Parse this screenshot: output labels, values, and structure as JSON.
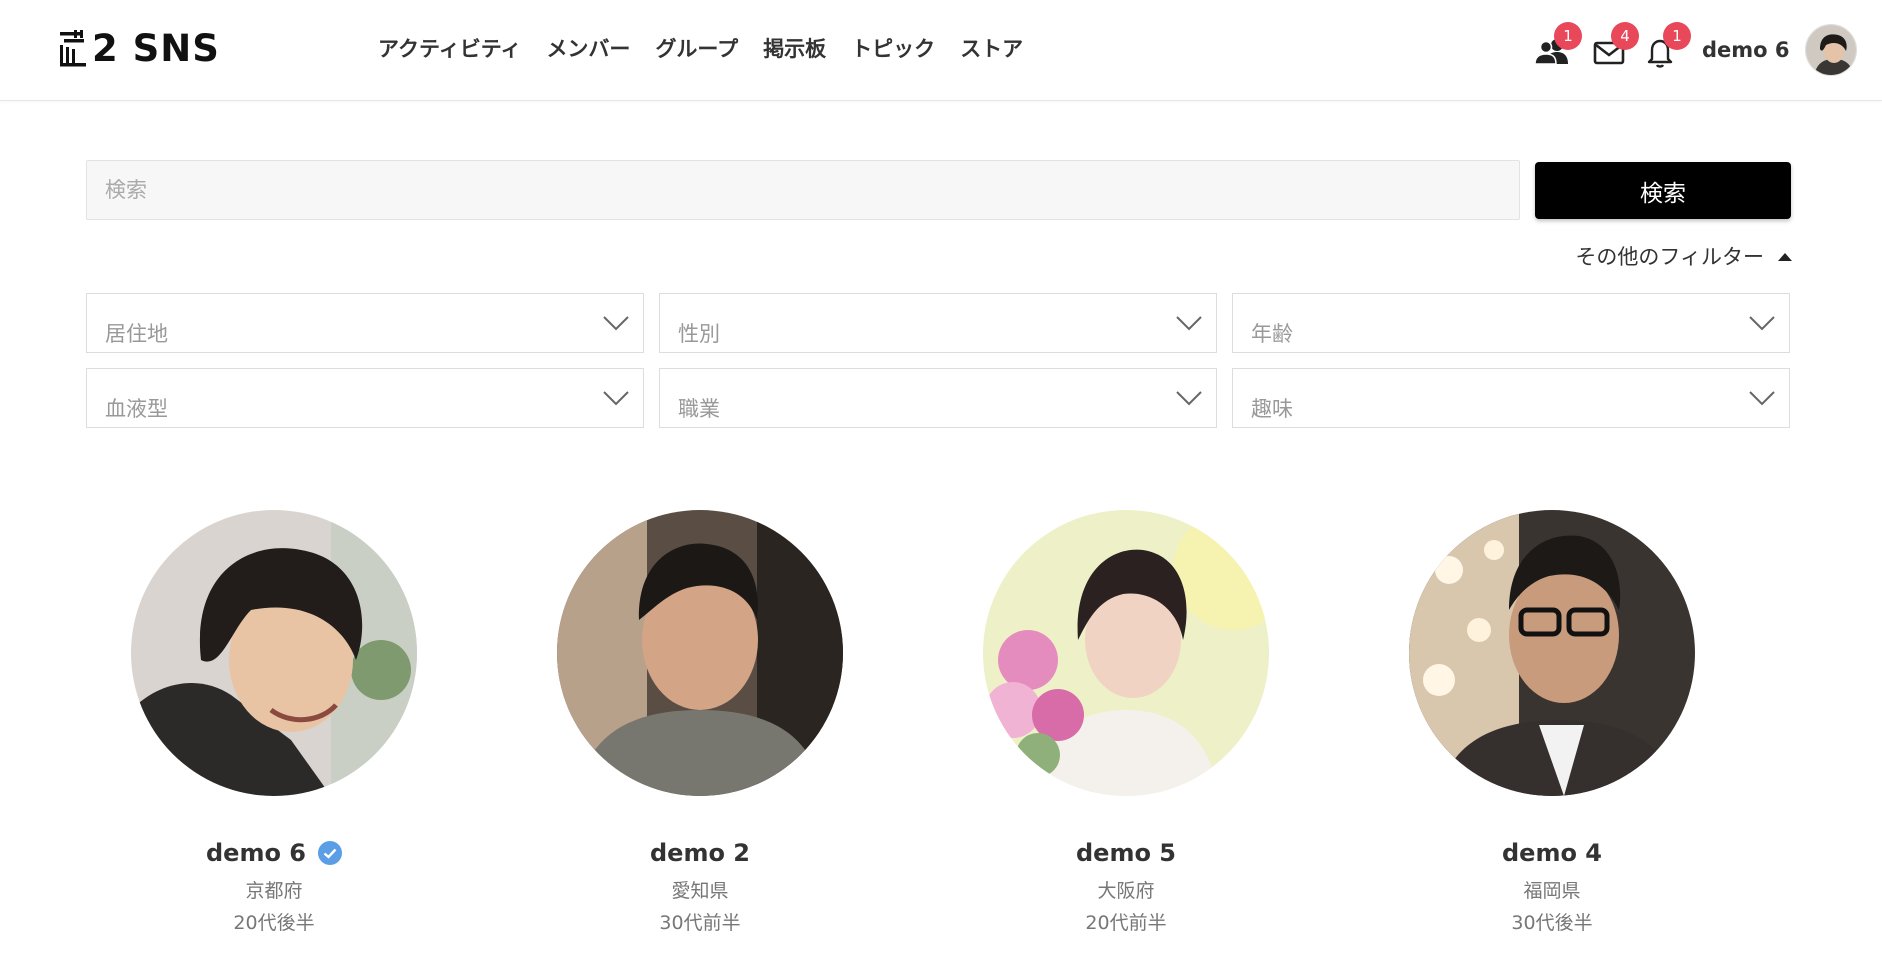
{
  "header": {
    "logo_text": "2 SNS",
    "nav": [
      {
        "label": "アクティビティ"
      },
      {
        "label": "メンバー"
      },
      {
        "label": "グループ"
      },
      {
        "label": "掲示板"
      },
      {
        "label": "トピック"
      },
      {
        "label": "ストア"
      }
    ],
    "icons": [
      {
        "name": "friends-icon",
        "badge": "1"
      },
      {
        "name": "mail-icon",
        "badge": "4"
      },
      {
        "name": "bell-icon",
        "badge": "1"
      }
    ],
    "user_name": "demo 6"
  },
  "search": {
    "placeholder": "検索",
    "button_label": "検索",
    "filter_toggle_label": "その他のフィルター"
  },
  "filters": [
    {
      "placeholder": "居住地"
    },
    {
      "placeholder": "性別"
    },
    {
      "placeholder": "年齢"
    },
    {
      "placeholder": "血液型"
    },
    {
      "placeholder": "職業"
    },
    {
      "placeholder": "趣味"
    }
  ],
  "members": [
    {
      "name": "demo 6",
      "location": "京都府",
      "age": "20代後半",
      "verified": true
    },
    {
      "name": "demo 2",
      "location": "愛知県",
      "age": "30代前半",
      "verified": false
    },
    {
      "name": "demo 5",
      "location": "大阪府",
      "age": "20代前半",
      "verified": false
    },
    {
      "name": "demo 4",
      "location": "福岡県",
      "age": "30代後半",
      "verified": false
    }
  ],
  "colors": {
    "badge": "#e8485a",
    "verified": "#5b9ee6",
    "button": "#000000"
  }
}
